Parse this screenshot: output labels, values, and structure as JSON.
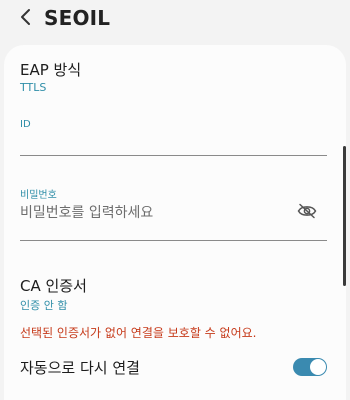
{
  "appbar": {
    "back_icon": "chevron-left-icon",
    "title": "SEOIL"
  },
  "eap": {
    "title": "EAP 방식",
    "value": "TTLS"
  },
  "identity": {
    "label": "ID",
    "value": ""
  },
  "password": {
    "label": "비밀번호",
    "placeholder": "비밀번호를 입력하세요",
    "toggle_icon": "eye-off-icon"
  },
  "ca_cert": {
    "title": "CA 인증서",
    "value": "인증 안 함",
    "warning": "선택된 인증서가 없어 연결을 보호할 수 없어요."
  },
  "auto_reconnect": {
    "label": "자동으로 다시 연결",
    "enabled": true
  },
  "colors": {
    "accent": "#2f8ea8",
    "warning": "#c63a1a",
    "toggle_on": "#3a8ab0",
    "background": "#f3f3f3",
    "card": "#fcfcfc"
  }
}
